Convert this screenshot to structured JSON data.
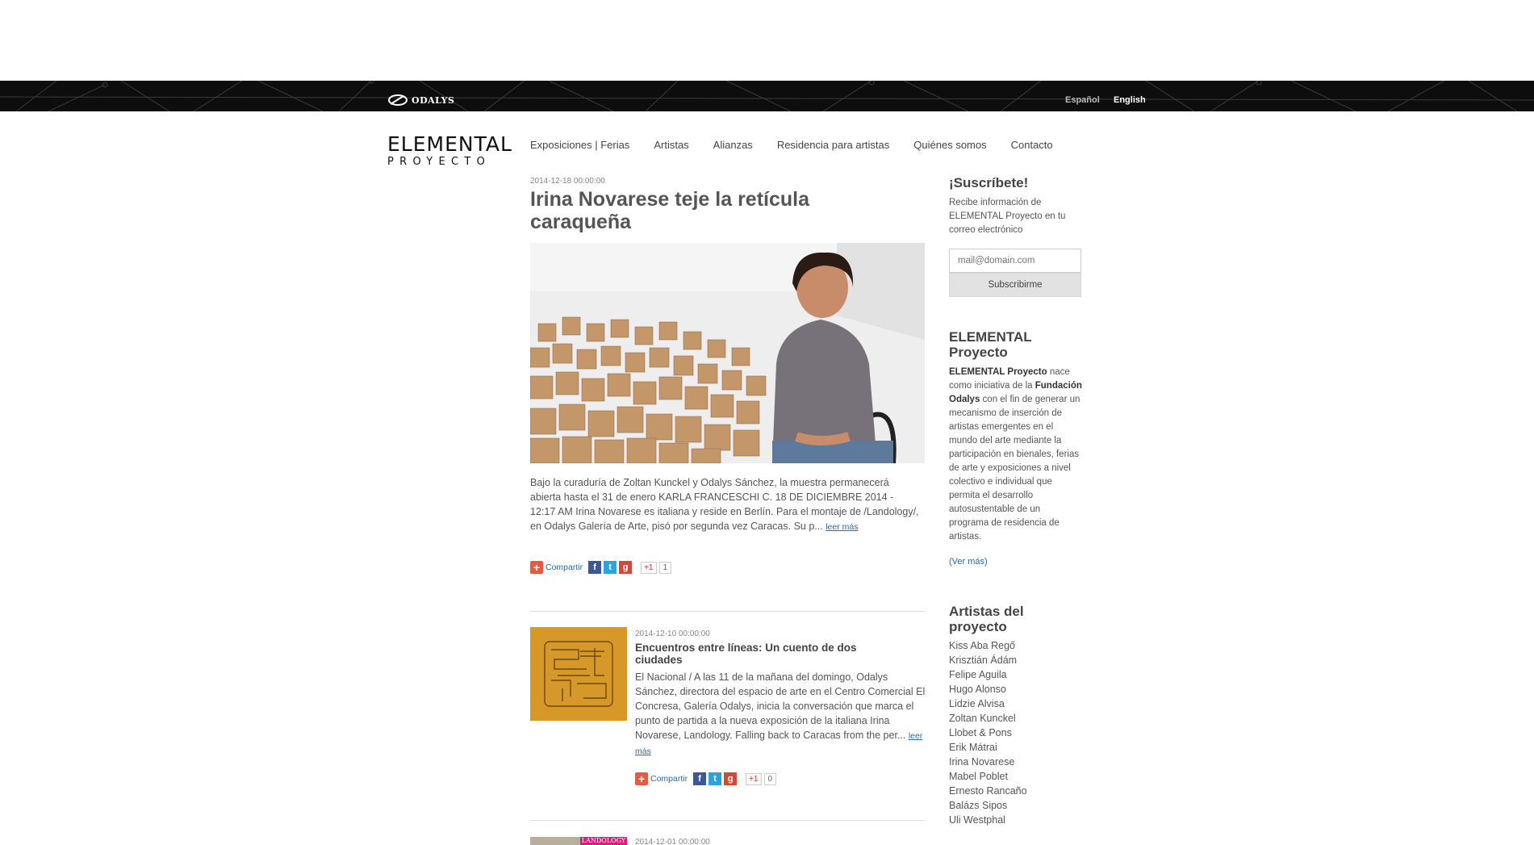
{
  "topbar": {
    "brand": "ODALYS",
    "lang_es": "Español",
    "lang_en": "English"
  },
  "header": {
    "logo_line1": "ELEMENTAL",
    "logo_line2": "PROYECTO",
    "nav": [
      "Exposiciones | Ferias",
      "Artistas",
      "Alianzas",
      "Residencia para artistas",
      "Quiénes somos",
      "Contacto"
    ]
  },
  "featured": {
    "date": "2014-12-18 00:00:00",
    "title": "Irina Novarese teje la retícula caraqueña",
    "excerpt": "Bajo la curaduría de Zoltan Kunckel y Odalys Sánchez, la muestra permanecerá abierta hasta el 31 de enero KARLA FRANCESCHI C. 18 DE DICIEMBRE 2014 - 12:17 AM Irina Novarese es italiana y reside en Berlín. Para el montaje de /Landology/, en Odalys Galería de Arte, pisó por segunda vez Caracas. Su p...",
    "more": "leer más",
    "share_label": "Compartir",
    "plusone": "+1",
    "count": "1"
  },
  "posts": [
    {
      "date": "2014-12-10 00:00:00",
      "title": "Encuentros entre líneas: Un cuento de dos ciudades",
      "excerpt": "El Nacional / A las 11 de la mañana del domingo, Odalys Sánchez, directora del espacio de arte en el Centro Comercial El Concresa, Galería Odalys, inicia la conversación que marca el punto de partida a la nueva exposición de la italiana Irina Novarese, Landology. Falling back to Caracas from the per...",
      "more": "leer más",
      "share_label": "Compartir",
      "plusone": "+1",
      "count": "0"
    },
    {
      "date": "2014-12-01 00:00:00",
      "thumb_label": "LANDOLOGY"
    }
  ],
  "sidebar": {
    "subscribe_title": "¡Suscríbete!",
    "subscribe_text": "Recibe información de ELEMENTAL Proyecto en tu correo electrónico",
    "email_placeholder": "mail@domain.com",
    "subscribe_button": "Subscribirme",
    "about_title": "ELEMENTAL Proyecto",
    "about_bold1": "ELEMENTAL Proyecto",
    "about_text1": " nace como iniciativa de la ",
    "about_bold2": "Fundación Odalys",
    "about_text2": " con el fin de generar un mecanismo de inserción de artistas emergentes en el mundo del arte mediante la participación en bienales, ferias de arte y exposiciones a nivel colectivo e individual que permita el desarrollo autosustentable de un programa de residencia de artistas.",
    "about_more": "(Ver más)",
    "artists_title": "Artistas del proyecto",
    "artists": [
      "Kiss Aba Regő",
      "Krisztián Ádám",
      "Felipe Aguila",
      "Hugo Alonso",
      "Lidzie Alvisa",
      "Zoltan Kunckel",
      "Llobet & Pons",
      "Erik Mátrai",
      "Irina Novarese",
      "Mabel Poblet",
      "Ernesto Rancaño",
      "Balázs Sipos",
      "Uli Westphal"
    ]
  }
}
